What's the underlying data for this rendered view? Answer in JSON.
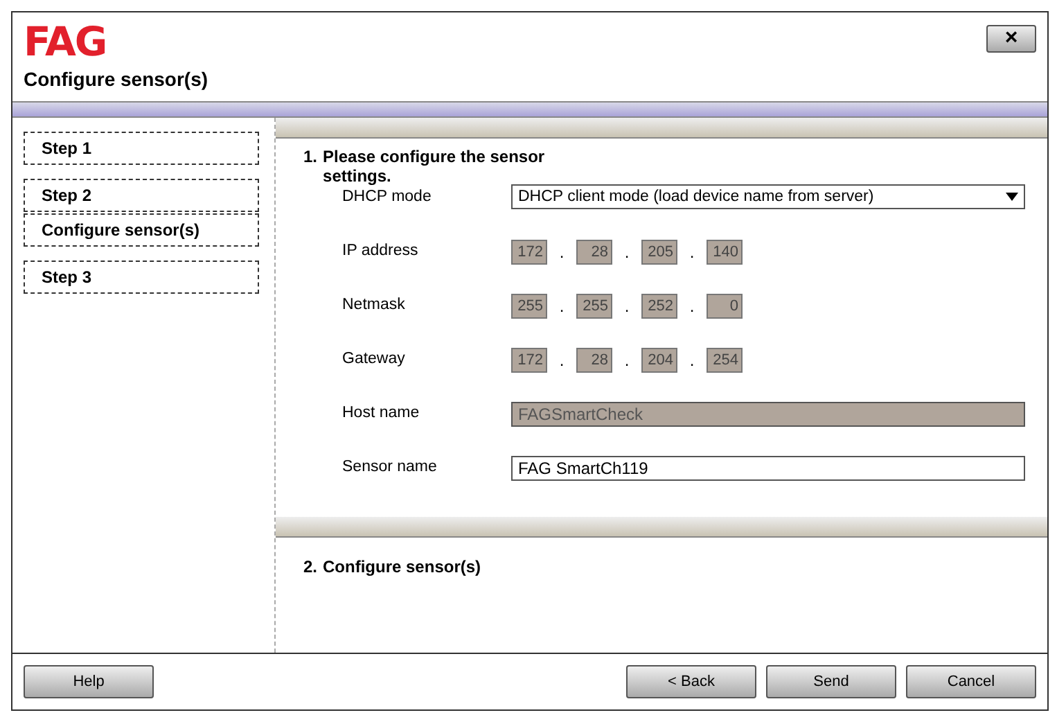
{
  "window": {
    "logo": "FAG",
    "title": "Configure sensor(s)",
    "close": "×"
  },
  "steps": [
    {
      "label": "Step 1"
    },
    {
      "label": "Step 2"
    },
    {
      "label": "Configure sensor(s)"
    },
    {
      "label": "Step 3"
    }
  ],
  "section_1": {
    "heading": "1.",
    "title": "Please configure the sensor settings.",
    "fields": [
      {
        "kind": "dropdown",
        "label": "DHCP mode",
        "value": "DHCP client mode (load device name from server)"
      },
      {
        "kind": "ip",
        "label": "IP address",
        "separator": ".",
        "octets": [
          "172",
          "28",
          "205",
          "140"
        ]
      },
      {
        "kind": "ip",
        "label": "Netmask",
        "separator": ".",
        "octets": [
          "255",
          "255",
          "252",
          "0"
        ]
      },
      {
        "kind": "ip",
        "label": "Gateway",
        "separator": ".",
        "octets": [
          "172",
          "28",
          "204",
          "254"
        ]
      },
      {
        "kind": "text",
        "label": "Host name",
        "value": "FAGSmartCheck",
        "disabled": true
      },
      {
        "kind": "text",
        "label": "Sensor name",
        "value": "FAG SmartCh119",
        "disabled": false
      }
    ]
  },
  "section_2": {
    "heading": "2.",
    "title": "Configure sensor(s)"
  },
  "buttons": {
    "left": [
      "Help"
    ],
    "right": [
      "< Back",
      "Send",
      "Cancel"
    ]
  }
}
